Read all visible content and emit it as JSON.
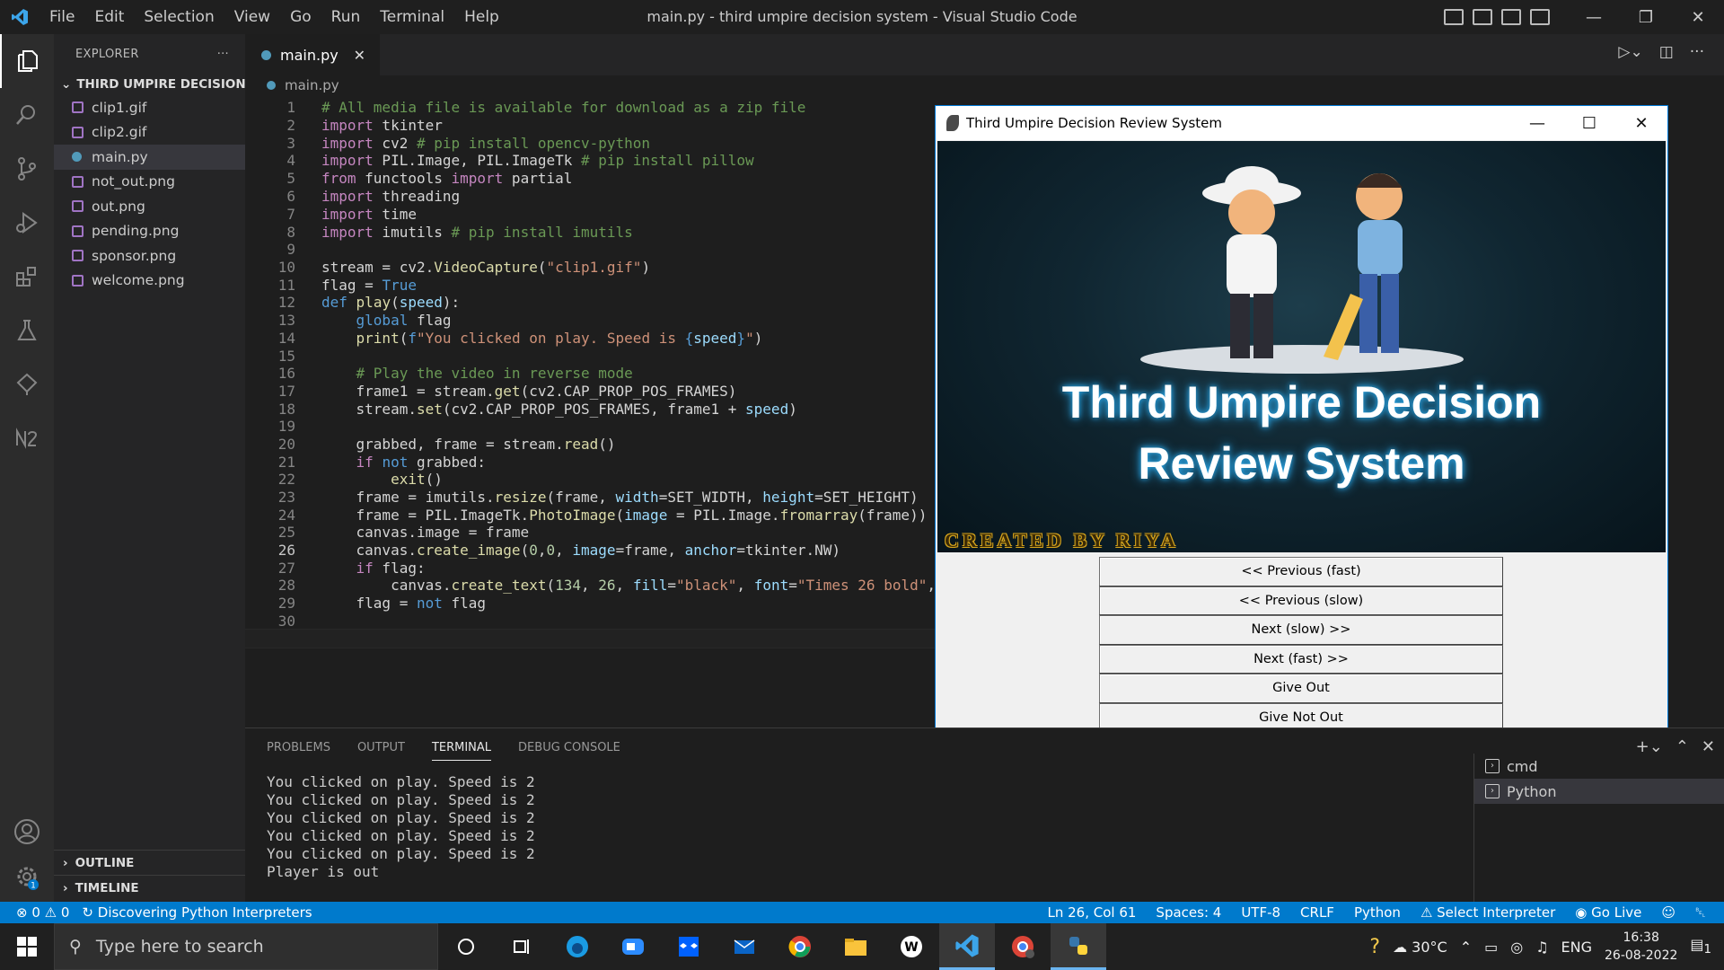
{
  "window": {
    "title": "main.py - third umpire decision system - Visual Studio Code",
    "menu": [
      "File",
      "Edit",
      "Selection",
      "View",
      "Go",
      "Run",
      "Terminal",
      "Help"
    ]
  },
  "sidebar": {
    "header": "EXPLORER",
    "folder": "THIRD UMPIRE DECISION ...",
    "files": [
      "clip1.gif",
      "clip2.gif",
      "main.py",
      "not_out.png",
      "out.png",
      "pending.png",
      "sponsor.png",
      "welcome.png"
    ],
    "active_file": "main.py",
    "outline": "OUTLINE",
    "timeline": "TIMELINE"
  },
  "editor": {
    "tab": "main.py",
    "breadcrumb": "main.py",
    "current_line": 26,
    "line_numbers": [
      "1",
      "2",
      "3",
      "4",
      "5",
      "6",
      "7",
      "8",
      "9",
      "10",
      "11",
      "12",
      "13",
      "14",
      "15",
      "16",
      "17",
      "18",
      "19",
      "20",
      "21",
      "22",
      "23",
      "24",
      "25",
      "26",
      "27",
      "28",
      "29",
      "30"
    ]
  },
  "panel": {
    "tabs": [
      "PROBLEMS",
      "OUTPUT",
      "TERMINAL",
      "DEBUG CONSOLE"
    ],
    "active_tab": "TERMINAL",
    "terminal_lines": [
      "You clicked on play. Speed is 2",
      "You clicked on play. Speed is 2",
      "You clicked on play. Speed is 2",
      "You clicked on play. Speed is 2",
      "You clicked on play. Speed is 2",
      "Player is out"
    ],
    "terminals": [
      "cmd",
      "Python"
    ]
  },
  "statusbar": {
    "errors": "0",
    "warnings": "0",
    "task": "Discovering Python Interpreters",
    "position": "Ln 26, Col 61",
    "spaces": "Spaces: 4",
    "encoding": "UTF-8",
    "eol": "CRLF",
    "language": "Python",
    "interpreter": "Select Interpreter",
    "golive": "Go Live"
  },
  "tkinter": {
    "title": "Third Umpire Decision Review System",
    "splash_line1": "Third Umpire Decision",
    "splash_line2": "Review System",
    "credit": "CREATED BY RIYA",
    "buttons": [
      "<< Previous (fast)",
      "<< Previous (slow)",
      "Next (slow) >>",
      "Next (fast) >>",
      "Give Out",
      "Give Not Out"
    ]
  },
  "taskbar": {
    "search_placeholder": "Type here to search",
    "temperature": "30°C",
    "language": "ENG",
    "time": "16:38",
    "date": "26-08-2022",
    "notifications": "1"
  },
  "colors": {
    "accent": "#007acc",
    "editor_bg": "#1e1e1e",
    "sidebar_bg": "#252526",
    "activity_bg": "#2c2c2c",
    "tk_bg": "#f0f0f0"
  }
}
